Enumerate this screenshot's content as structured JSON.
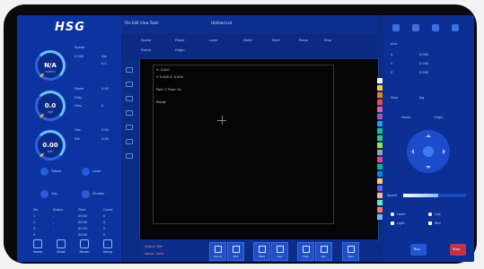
{
  "brand": {
    "logo": "HSG"
  },
  "gauges": [
    {
      "value": "N/A",
      "unit": "m/min"
    },
    {
      "value": "0.0",
      "unit": "kW"
    },
    {
      "value": "0.00",
      "unit": "bar"
    }
  ],
  "left_labels": {
    "g1a": "Speed",
    "g1b": "0.000",
    "g1c": "Set",
    "g1d": "0.0",
    "g2a": "Power",
    "g2b": "0.00",
    "g2c": "Duty",
    "g2d": "Freq",
    "g2e": "0",
    "g3a": "Gas",
    "g3b": "0.00",
    "g3c": "Set",
    "g3d": "0.00",
    "t1": "Follow",
    "t2": "Laser",
    "t3": "Gas",
    "t4": "Shutter"
  },
  "table": {
    "headers": [
      "No.",
      "Status",
      "Time",
      "Count"
    ],
    "rows": [
      [
        "1",
        "-",
        "00:00",
        "0"
      ],
      [
        "2",
        "-",
        "00:00",
        "0"
      ],
      [
        "3",
        "-",
        "00:00",
        "0"
      ],
      [
        "4",
        "-",
        "00:00",
        "0"
      ]
    ]
  },
  "bottom_nav": [
    "Home",
    "Draw",
    "Param",
    "Setup"
  ],
  "topbar": {
    "menu": "File  Edit  View  Tools",
    "file": "Untitled.lxd"
  },
  "toolbar": {
    "c1": "Speed",
    "c2": "Power",
    "c3": "Layer",
    "c4": "Mode",
    "c5": "Start",
    "c6": "Pause",
    "c7": "Stop",
    "c8": "Frame",
    "c9": "Origin"
  },
  "canvas": {
    "line1": "X: 0.000",
    "line2": "Y: 0.000  Z: 0.000",
    "line3": "Part: 0  Time: 0s",
    "line4": "Ready"
  },
  "palette": [
    "#f5f5f5",
    "#f7c948",
    "#e67e22",
    "#e74c3c",
    "#d35fb7",
    "#9b59b6",
    "#3498db",
    "#1abc9c",
    "#2ecc71",
    "#a3e048",
    "#95a5a6",
    "#e84393",
    "#00b894",
    "#0984e3",
    "#fdcb6e",
    "#6c5ce7",
    "#fab1a0",
    "#55efc4",
    "#ff7675",
    "#74b9ff"
  ],
  "footer_buttons": [
    "Import",
    "Edit",
    "Nest",
    "Sort",
    "Path",
    "Run",
    "Save"
  ],
  "footer_status": [
    "Status: Idle",
    "Alarm: none"
  ],
  "right_panel": {
    "r1": "Axis",
    "r2": "X",
    "r3": "Y",
    "r4": "Z",
    "r5": "0.000",
    "r6": "0.000",
    "r7": "0.000",
    "r8": "Step",
    "r9": "Jog",
    "r10": "Home",
    "r11": "Origin",
    "speed_label": "Speed",
    "speed_fraction": 0.55,
    "o1": "Laser",
    "o2": "Gas",
    "o3": "Light",
    "o4": "Red",
    "b1": "Run",
    "b2": "Stop"
  }
}
